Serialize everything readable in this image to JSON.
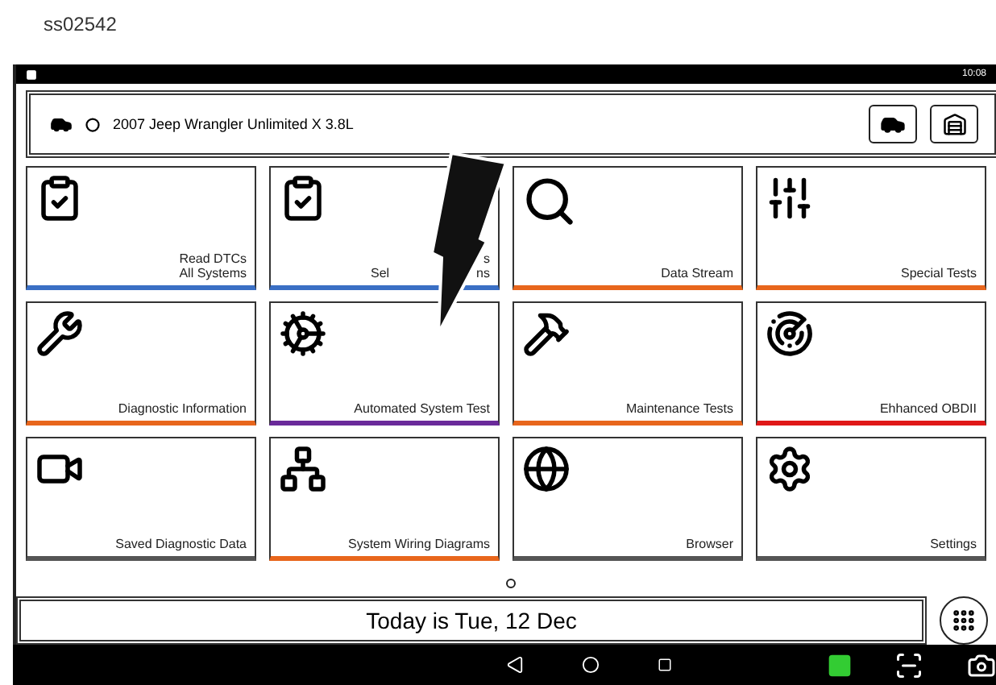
{
  "caption": "ss02542",
  "status_bar": {
    "time": "10:08"
  },
  "vehicle": {
    "name": "2007 Jeep Wrangler Unlimited X 3.8L"
  },
  "tiles": [
    {
      "kind": "dtc",
      "lines": [
        [
          "Read DTCs"
        ],
        [
          "All Systems"
        ]
      ],
      "color": "#3a6fc4"
    },
    {
      "kind": "dtc-select",
      "lines": [
        [
          "s"
        ],
        [
          "Sel",
          "ns"
        ]
      ],
      "color": "#3a6fc4"
    },
    {
      "kind": "data",
      "lines": [
        [
          "Data Stream"
        ]
      ],
      "color": "#e8661c"
    },
    {
      "kind": "special",
      "lines": [
        [
          "Special Tests"
        ]
      ],
      "color": "#e8661c"
    },
    {
      "kind": "book",
      "lines": [
        [
          "Diagnostic Information"
        ]
      ],
      "color": "#e8661c"
    },
    {
      "kind": "gears",
      "lines": [
        [
          "Automated System Test"
        ]
      ],
      "color": "#6a2a9a"
    },
    {
      "kind": "tools",
      "lines": [
        [
          "Maintenance Tests"
        ]
      ],
      "color": "#e8661c"
    },
    {
      "kind": "radar",
      "lines": [
        [
          "Ehhanced OBDII"
        ]
      ],
      "color": "#e01818"
    },
    {
      "kind": "camera",
      "lines": [
        [
          "Saved Diagnostic Data"
        ]
      ],
      "color": "#555555"
    },
    {
      "kind": "wiring",
      "lines": [
        [
          "System Wiring Diagrams"
        ]
      ],
      "color": "#e8661c"
    },
    {
      "kind": "globe",
      "lines": [
        [
          "Browser"
        ]
      ],
      "color": "#555555"
    },
    {
      "kind": "settings",
      "lines": [
        [
          "Settings"
        ]
      ],
      "color": "#555555"
    }
  ],
  "date_bar": {
    "text": "Today is Tue, 12 Dec"
  }
}
